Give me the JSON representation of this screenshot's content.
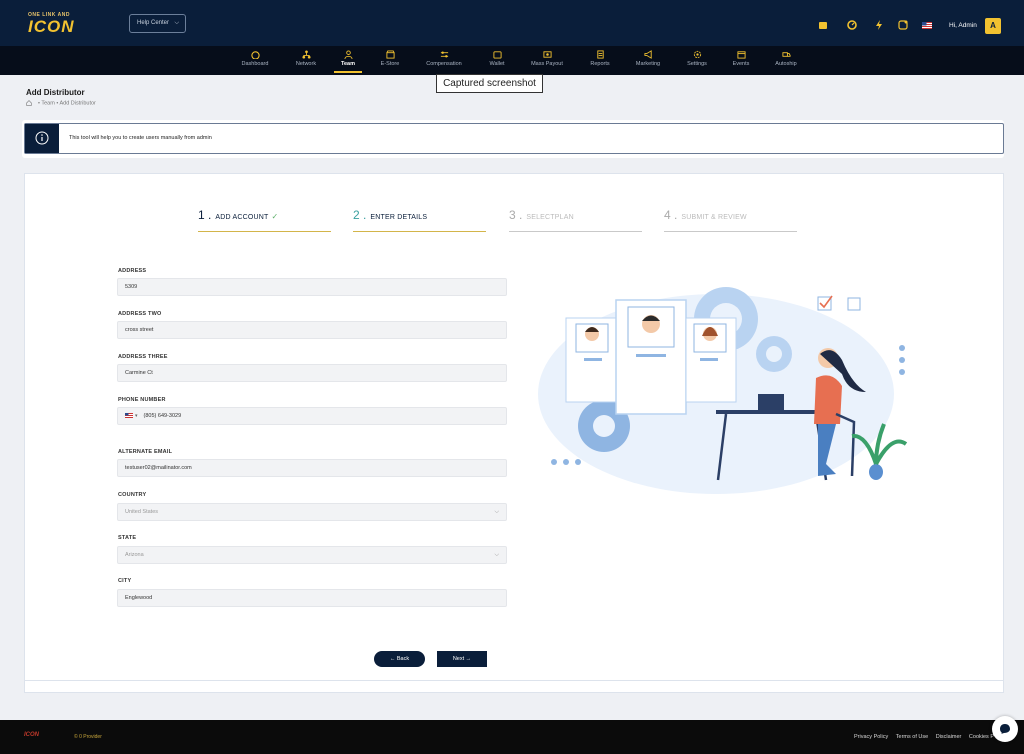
{
  "header": {
    "logo_small": "ONE LINK AND",
    "logo_main": "ICON",
    "help_center": "Help Center",
    "greeting": "Hi, Admin",
    "avatar_initial": "A"
  },
  "nav": [
    {
      "label": "Dashboard",
      "icon": "dashboard-icon"
    },
    {
      "label": "Network",
      "icon": "network-icon"
    },
    {
      "label": "Team",
      "icon": "team-icon",
      "active": true
    },
    {
      "label": "E-Store",
      "icon": "store-icon"
    },
    {
      "label": "Compensation",
      "icon": "sliders-icon"
    },
    {
      "label": "Wallet",
      "icon": "wallet-icon"
    },
    {
      "label": "Mass Payout",
      "icon": "payout-icon"
    },
    {
      "label": "Reports",
      "icon": "report-icon"
    },
    {
      "label": "Marketing",
      "icon": "megaphone-icon"
    },
    {
      "label": "Settings",
      "icon": "gear-icon"
    },
    {
      "label": "Events",
      "icon": "calendar-icon"
    },
    {
      "label": "Autoship",
      "icon": "truck-icon"
    }
  ],
  "tooltip": "Captured screenshot",
  "page": {
    "title": "Add Distributor",
    "breadcrumb": "• Team • Add Distributor"
  },
  "info": {
    "text": "This tool will help you to create users manually from admin"
  },
  "steps": [
    {
      "num": "1 .",
      "label": "ADD ACCOUNT",
      "check": "✓"
    },
    {
      "num": "2 .",
      "label": "ENTER DETAILS"
    },
    {
      "num": "3 .",
      "label": "SELECTPLAN"
    },
    {
      "num": "4 .",
      "label": "SUBMIT & REVIEW"
    }
  ],
  "form": {
    "address_label": "ADDRESS",
    "address_value": "5309",
    "address_two_label": "ADDRESS TWO",
    "address_two_value": "cross street",
    "address_three_label": "ADDRESS THREE",
    "address_three_value": "Carmine Ct",
    "phone_label": "PHONE NUMBER",
    "phone_value": "(805) 649-3029",
    "alt_email_label": "ALTERNATE EMAIL",
    "alt_email_value": "testuser02@mailinator.com",
    "country_label": "COUNTRY",
    "country_value": "United States",
    "state_label": "STATE",
    "state_value": "Arizona",
    "city_label": "CITY",
    "city_value": "Englewood"
  },
  "buttons": {
    "back": "← Back",
    "next": "Next →"
  },
  "footer": {
    "logo": "ICON",
    "copyright": "© 0 Provider",
    "links": [
      "Privacy Policy",
      "Terms of Use",
      "Disclaimer",
      "Cookies P"
    ]
  },
  "colors": {
    "navy": "#0a1e3a",
    "gold": "#f2c230",
    "teal": "#3aa0a0",
    "light_blue": "#cfe3f7"
  }
}
